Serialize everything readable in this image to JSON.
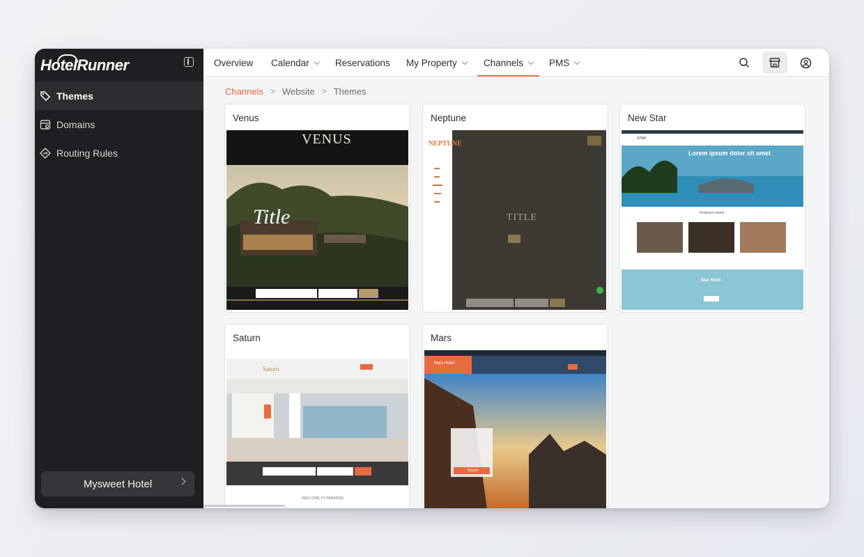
{
  "app": {
    "logo_text": "HotelRunner"
  },
  "sidebar": {
    "items": [
      {
        "label": "Themes",
        "icon": "themes-icon",
        "active": true
      },
      {
        "label": "Domains",
        "icon": "domains-icon",
        "active": false
      },
      {
        "label": "Routing Rules",
        "icon": "routing-icon",
        "active": false
      }
    ],
    "hotel_switch": "Mysweet Hotel"
  },
  "topnav": {
    "tabs": [
      {
        "label": "Overview",
        "dropdown": false
      },
      {
        "label": "Calendar",
        "dropdown": true
      },
      {
        "label": "Reservations",
        "dropdown": false
      },
      {
        "label": "My Property",
        "dropdown": true
      },
      {
        "label": "Channels",
        "dropdown": true,
        "active": true
      },
      {
        "label": "PMS",
        "dropdown": true
      }
    ]
  },
  "breadcrumb": {
    "items": [
      "Channels",
      "Website",
      "Themes"
    ]
  },
  "themes": [
    {
      "name": "Venus",
      "preview_title": "Title",
      "preview_logo": "VENUS"
    },
    {
      "name": "Neptune",
      "preview_title": "TITLE",
      "preview_logo": "NEPTUNE"
    },
    {
      "name": "New Star",
      "preview_heading": "Lorem ipsum dolor sit amet",
      "preview_section": "Featured rooms",
      "preview_footer_title": "Star Hotel",
      "preview_logo": "STAR"
    },
    {
      "name": "Saturn",
      "preview_logo": "Saturn",
      "preview_footer": "WELCOME TO PARADISE"
    },
    {
      "name": "Mars",
      "preview_logo": "Mars Hotel",
      "preview_button": "Search"
    }
  ],
  "colors": {
    "accent": "#e76b3f",
    "sidebar_bg": "#1e1f22"
  }
}
